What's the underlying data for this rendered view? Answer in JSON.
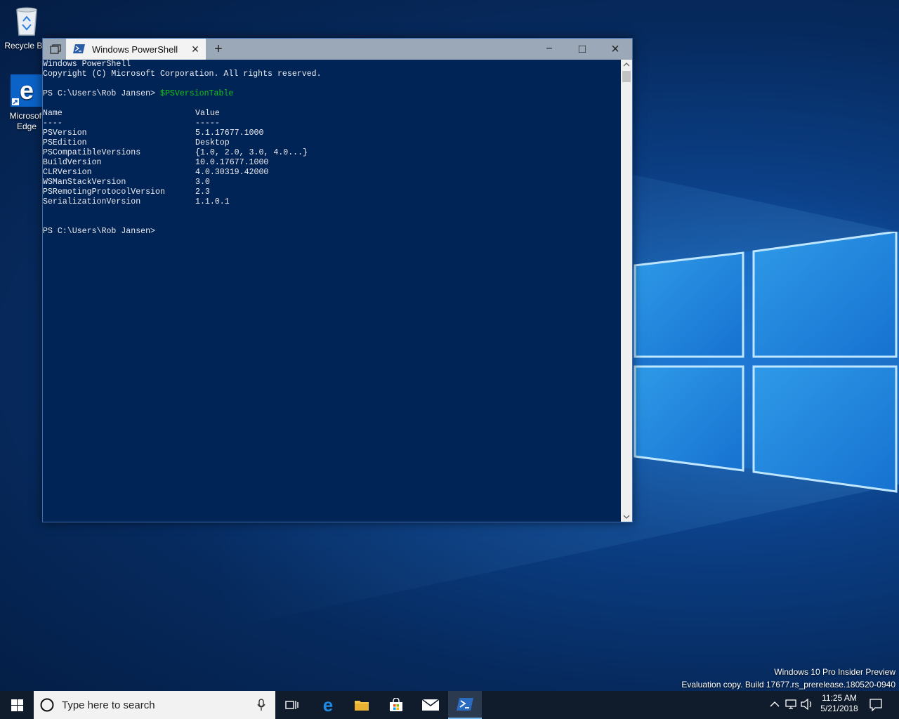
{
  "desktop": {
    "icons": [
      {
        "label": "Recycle Bin"
      },
      {
        "label": "Microsoft Edge"
      }
    ],
    "watermark": {
      "line1": "Windows 10 Pro Insider Preview",
      "line2": "Evaluation copy. Build 17677.rs_prerelease.180520-0940"
    }
  },
  "window": {
    "tab_title": "Windows PowerShell",
    "new_tab": "+",
    "minimize": "−",
    "maximize": "□",
    "close": "×"
  },
  "console": {
    "header1": "Windows PowerShell",
    "header2": "Copyright (C) Microsoft Corporation. All rights reserved.",
    "prompt1": "PS C:\\Users\\Rob Jansen> ",
    "command": "$PSVersionTable",
    "col_name": "Name",
    "col_value": "Value",
    "sep_name": "----",
    "sep_value": "-----",
    "rows": [
      {
        "name": "PSVersion",
        "value": "5.1.17677.1000"
      },
      {
        "name": "PSEdition",
        "value": "Desktop"
      },
      {
        "name": "PSCompatibleVersions",
        "value": "{1.0, 2.0, 3.0, 4.0...}"
      },
      {
        "name": "BuildVersion",
        "value": "10.0.17677.1000"
      },
      {
        "name": "CLRVersion",
        "value": "4.0.30319.42000"
      },
      {
        "name": "WSManStackVersion",
        "value": "3.0"
      },
      {
        "name": "PSRemotingProtocolVersion",
        "value": "2.3"
      },
      {
        "name": "SerializationVersion",
        "value": "1.1.0.1"
      }
    ],
    "prompt2": "PS C:\\Users\\Rob Jansen>"
  },
  "taskbar": {
    "search_placeholder": "Type here to search",
    "time": "11:25 AM",
    "date": "5/21/2018"
  },
  "colors": {
    "console_bg": "#012456",
    "console_fg": "#eeedf0",
    "command": "#13c413",
    "taskbar": "#101c2c"
  }
}
